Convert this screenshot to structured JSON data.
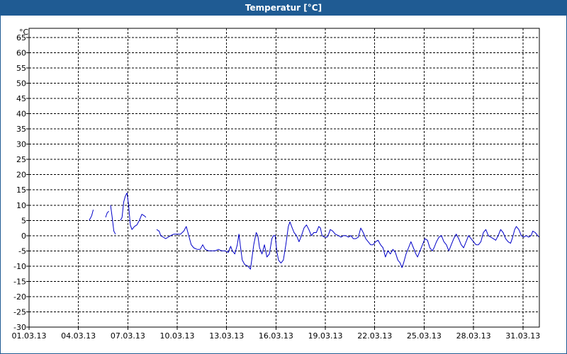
{
  "window": {
    "title": "Temperatur [°C]"
  },
  "chart_data": {
    "type": "line",
    "title": "Temperatur [°C]",
    "ylabel": "°C",
    "ylim": [
      -30,
      68
    ],
    "y_ticks": [
      65,
      60,
      55,
      50,
      45,
      40,
      35,
      30,
      25,
      20,
      15,
      10,
      5,
      0,
      -5,
      -10,
      -15,
      -20,
      -25,
      -30
    ],
    "xlim": [
      "01.03.13",
      "01.04.13"
    ],
    "x_ticks": [
      "01.03.13",
      "04.03.13",
      "07.03.13",
      "10.03.13",
      "13.03.13",
      "16.03.13",
      "19.03.13",
      "22.03.13",
      "25.03.13",
      "28.03.13",
      "31.03.13"
    ],
    "grid": true,
    "series": [
      {
        "color": "#0000c8",
        "segments": [
          [
            [
              4.65,
              5
            ],
            [
              4.8,
              6.5
            ],
            [
              4.9,
              8.5
            ]
          ],
          [
            [
              5.65,
              6
            ],
            [
              5.75,
              7.5
            ],
            [
              5.85,
              8
            ]
          ],
          [
            [
              5.95,
              10
            ],
            [
              6.05,
              6
            ],
            [
              6.15,
              1.5
            ],
            [
              6.25,
              0.5
            ]
          ],
          [
            [
              6.55,
              5
            ],
            [
              6.65,
              6
            ],
            [
              6.75,
              11
            ],
            [
              6.85,
              13
            ],
            [
              6.95,
              14
            ],
            [
              7.05,
              10
            ],
            [
              7.15,
              3.5
            ],
            [
              7.25,
              2
            ],
            [
              7.4,
              3
            ],
            [
              7.55,
              3.5
            ],
            [
              7.7,
              5
            ],
            [
              7.85,
              7
            ],
            [
              8.0,
              6.5
            ],
            [
              8.1,
              6
            ]
          ],
          [
            [
              8.75,
              2
            ],
            [
              8.9,
              1.5
            ],
            [
              9.0,
              0
            ],
            [
              9.15,
              -0.5
            ],
            [
              9.3,
              -1
            ],
            [
              9.45,
              -0.5
            ],
            [
              9.6,
              0
            ],
            [
              9.8,
              0.5
            ],
            [
              10.0,
              0.5
            ],
            [
              10.2,
              0.5
            ],
            [
              10.4,
              1.5
            ],
            [
              10.55,
              3
            ],
            [
              10.7,
              0
            ],
            [
              10.85,
              -3
            ],
            [
              11.0,
              -4
            ],
            [
              11.2,
              -4.5
            ],
            [
              11.4,
              -4.5
            ],
            [
              11.55,
              -3
            ],
            [
              11.7,
              -4.5
            ],
            [
              11.9,
              -5
            ],
            [
              12.1,
              -5
            ],
            [
              12.3,
              -5
            ],
            [
              12.5,
              -4.5
            ],
            [
              12.7,
              -5
            ],
            [
              12.9,
              -5
            ],
            [
              13.1,
              -5.5
            ],
            [
              13.25,
              -3.5
            ],
            [
              13.35,
              -5
            ],
            [
              13.5,
              -6
            ],
            [
              13.65,
              -3
            ],
            [
              13.75,
              0.5
            ],
            [
              13.85,
              -4
            ],
            [
              13.95,
              -8
            ],
            [
              14.1,
              -9.5
            ],
            [
              14.3,
              -10
            ],
            [
              14.45,
              -11
            ],
            [
              14.55,
              -7
            ],
            [
              14.65,
              -3
            ],
            [
              14.8,
              1
            ],
            [
              14.9,
              0
            ],
            [
              15.0,
              -4
            ],
            [
              15.15,
              -6
            ],
            [
              15.3,
              -3
            ],
            [
              15.45,
              -7
            ],
            [
              15.6,
              -6
            ],
            [
              15.75,
              -1
            ],
            [
              15.85,
              0
            ],
            [
              15.95,
              0
            ],
            [
              16.05,
              -5
            ],
            [
              16.15,
              -8
            ],
            [
              16.3,
              -9
            ],
            [
              16.45,
              -8
            ],
            [
              16.6,
              -3
            ],
            [
              16.75,
              3
            ],
            [
              16.85,
              4.5
            ],
            [
              16.95,
              3
            ],
            [
              17.1,
              1
            ],
            [
              17.25,
              0
            ],
            [
              17.4,
              -2
            ],
            [
              17.55,
              0
            ],
            [
              17.7,
              2.5
            ],
            [
              17.85,
              3.5
            ],
            [
              18.0,
              2
            ],
            [
              18.15,
              0
            ],
            [
              18.3,
              1
            ],
            [
              18.45,
              1
            ],
            [
              18.6,
              3
            ],
            [
              18.7,
              2.5
            ],
            [
              18.8,
              0
            ],
            [
              18.95,
              -0.5
            ],
            [
              19.1,
              -0.5
            ],
            [
              19.2,
              0.5
            ],
            [
              19.3,
              2
            ],
            [
              19.45,
              1.5
            ],
            [
              19.6,
              0.5
            ],
            [
              19.8,
              0
            ],
            [
              19.95,
              -0.5
            ],
            [
              20.1,
              0
            ],
            [
              20.25,
              0
            ],
            [
              20.4,
              -0.5
            ],
            [
              20.55,
              0
            ],
            [
              20.7,
              -1
            ],
            [
              20.85,
              -1
            ],
            [
              21.0,
              -0.5
            ],
            [
              21.15,
              2.5
            ],
            [
              21.3,
              1
            ],
            [
              21.45,
              -1
            ],
            [
              21.6,
              -2
            ],
            [
              21.75,
              -3
            ],
            [
              21.9,
              -3
            ],
            [
              22.05,
              -2
            ],
            [
              22.2,
              -1.5
            ],
            [
              22.35,
              -3
            ],
            [
              22.5,
              -4
            ],
            [
              22.65,
              -7
            ],
            [
              22.8,
              -5
            ],
            [
              22.95,
              -6
            ],
            [
              23.1,
              -4.5
            ],
            [
              23.25,
              -5.5
            ],
            [
              23.4,
              -8
            ],
            [
              23.55,
              -9
            ],
            [
              23.65,
              -10.5
            ],
            [
              23.75,
              -9
            ],
            [
              23.9,
              -6
            ],
            [
              24.05,
              -4
            ],
            [
              24.2,
              -2
            ],
            [
              24.35,
              -4
            ],
            [
              24.5,
              -6
            ],
            [
              24.6,
              -7
            ],
            [
              24.75,
              -5
            ],
            [
              24.9,
              -3
            ],
            [
              25.05,
              -1
            ],
            [
              25.2,
              -1.5
            ],
            [
              25.35,
              -4
            ],
            [
              25.5,
              -5
            ],
            [
              25.6,
              -4
            ],
            [
              25.75,
              -2
            ],
            [
              25.9,
              -0.5
            ],
            [
              26.05,
              0
            ],
            [
              26.2,
              -2
            ],
            [
              26.35,
              -3
            ],
            [
              26.5,
              -5
            ],
            [
              26.65,
              -3
            ],
            [
              26.8,
              -1
            ],
            [
              26.95,
              0.5
            ],
            [
              27.1,
              -1
            ],
            [
              27.25,
              -3
            ],
            [
              27.4,
              -4
            ],
            [
              27.55,
              -2
            ],
            [
              27.7,
              0
            ],
            [
              27.85,
              -1
            ],
            [
              28.0,
              -2
            ],
            [
              28.15,
              -3
            ],
            [
              28.3,
              -3
            ],
            [
              28.45,
              -2
            ],
            [
              28.6,
              1
            ],
            [
              28.75,
              2
            ],
            [
              28.9,
              0
            ],
            [
              29.05,
              -0.5
            ],
            [
              29.2,
              -1
            ],
            [
              29.35,
              -1.5
            ],
            [
              29.5,
              0
            ],
            [
              29.65,
              2
            ],
            [
              29.8,
              1
            ],
            [
              29.95,
              -1
            ],
            [
              30.1,
              -2
            ],
            [
              30.25,
              -2.5
            ],
            [
              30.35,
              -1
            ],
            [
              30.5,
              2
            ],
            [
              30.6,
              3
            ],
            [
              30.75,
              2
            ],
            [
              30.9,
              0
            ],
            [
              31.05,
              -0.5
            ],
            [
              31.2,
              0
            ],
            [
              31.35,
              -0.5
            ],
            [
              31.5,
              0
            ],
            [
              31.6,
              1.5
            ],
            [
              31.75,
              1
            ],
            [
              31.9,
              0
            ],
            [
              32.0,
              -0.5
            ]
          ]
        ]
      }
    ]
  }
}
